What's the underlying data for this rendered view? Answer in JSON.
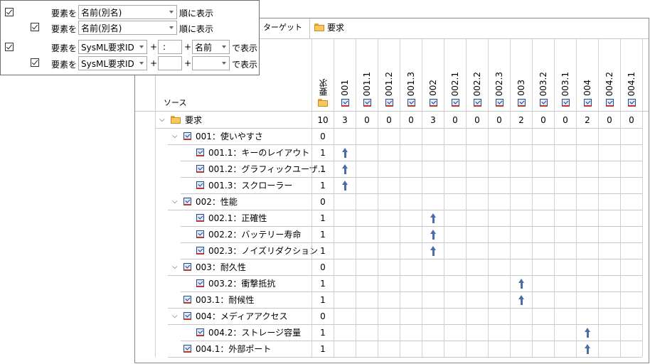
{
  "options_panel": {
    "rows": [
      {
        "checked": true,
        "prefix": "要素を",
        "select": "名前(別名)",
        "suffix": "順に表示"
      },
      {
        "checked": true,
        "prefix": "要素を",
        "select": "名前(別名)",
        "suffix": "順に表示"
      },
      {
        "checked": true,
        "prefix": "要素を",
        "select1": "SysML要求ID",
        "plus1": "+",
        "sep": ":",
        "plus2": "+",
        "select2": "名前",
        "suffix": "で表示"
      },
      {
        "checked": true,
        "prefix": "要素を",
        "select1": "SysML要求ID",
        "plus1": "+",
        "sep": "",
        "plus2": "+",
        "select2": "",
        "suffix": "で表示"
      }
    ]
  },
  "matrix": {
    "target_label": "ターゲット",
    "source_label": "ソース",
    "group_name": "要求",
    "columns": [
      {
        "label": "要求",
        "icon": "folder-icon",
        "total": "10"
      },
      {
        "label": "001",
        "icon": "requirement-icon",
        "total": "3"
      },
      {
        "label": "001.1",
        "icon": "requirement-icon",
        "total": "0"
      },
      {
        "label": "001.2",
        "icon": "requirement-icon",
        "total": "0"
      },
      {
        "label": "001.3",
        "icon": "requirement-icon",
        "total": "0"
      },
      {
        "label": "002",
        "icon": "requirement-icon",
        "total": "3"
      },
      {
        "label": "002.1",
        "icon": "requirement-icon",
        "total": "0"
      },
      {
        "label": "002.2",
        "icon": "requirement-icon",
        "total": "0"
      },
      {
        "label": "002.3",
        "icon": "requirement-icon",
        "total": "0"
      },
      {
        "label": "003",
        "icon": "requirement-icon",
        "total": "2"
      },
      {
        "label": "003.2",
        "icon": "requirement-icon",
        "total": "0"
      },
      {
        "label": "003.1",
        "icon": "requirement-icon",
        "total": "0"
      },
      {
        "label": "004",
        "icon": "requirement-icon",
        "total": "2"
      },
      {
        "label": "004.2",
        "icon": "requirement-icon",
        "total": "0"
      },
      {
        "label": "004.1",
        "icon": "requirement-icon",
        "total": "0"
      }
    ],
    "rows": [
      {
        "name": "要求",
        "level": 0,
        "icon": "folder-icon",
        "expandable": true,
        "count": "10",
        "arrow_col": null
      },
      {
        "name": "001：使いやすさ",
        "level": 1,
        "icon": "requirement-icon",
        "expandable": true,
        "count": "0",
        "arrow_col": null
      },
      {
        "name": "001.1：キーのレイアウト",
        "level": 2,
        "icon": "requirement-icon",
        "expandable": false,
        "count": "1",
        "arrow_col": 1
      },
      {
        "name": "001.2：グラフィックユーザ...",
        "level": 2,
        "icon": "requirement-icon",
        "expandable": false,
        "count": "1",
        "arrow_col": 1
      },
      {
        "name": "001.3：スクローラー",
        "level": 2,
        "icon": "requirement-icon",
        "expandable": false,
        "count": "1",
        "arrow_col": 1
      },
      {
        "name": "002：性能",
        "level": 1,
        "icon": "requirement-icon",
        "expandable": true,
        "count": "0",
        "arrow_col": null
      },
      {
        "name": "002.1：正確性",
        "level": 2,
        "icon": "requirement-icon",
        "expandable": false,
        "count": "1",
        "arrow_col": 5
      },
      {
        "name": "002.2：バッテリー寿命",
        "level": 2,
        "icon": "requirement-icon",
        "expandable": false,
        "count": "1",
        "arrow_col": 5
      },
      {
        "name": "002.3：ノイズリダクション",
        "level": 2,
        "icon": "requirement-icon",
        "expandable": false,
        "count": "1",
        "arrow_col": 5
      },
      {
        "name": "003：耐久性",
        "level": 1,
        "icon": "requirement-icon",
        "expandable": true,
        "count": "0",
        "arrow_col": null
      },
      {
        "name": "003.2：衝撃抵抗",
        "level": 2,
        "icon": "requirement-icon",
        "expandable": false,
        "count": "1",
        "arrow_col": 9
      },
      {
        "name": "003.1：耐候性",
        "level": 1,
        "icon": "requirement-icon",
        "expandable": false,
        "count": "1",
        "arrow_col": 9
      },
      {
        "name": "004：メディアアクセス",
        "level": 1,
        "icon": "requirement-icon",
        "expandable": true,
        "count": "0",
        "arrow_col": null
      },
      {
        "name": "004.2：ストレージ容量",
        "level": 2,
        "icon": "requirement-icon",
        "expandable": false,
        "count": "1",
        "arrow_col": 12
      },
      {
        "name": "004.1：外部ポート",
        "level": 1,
        "icon": "requirement-icon",
        "expandable": false,
        "count": "1",
        "arrow_col": 12
      }
    ]
  }
}
